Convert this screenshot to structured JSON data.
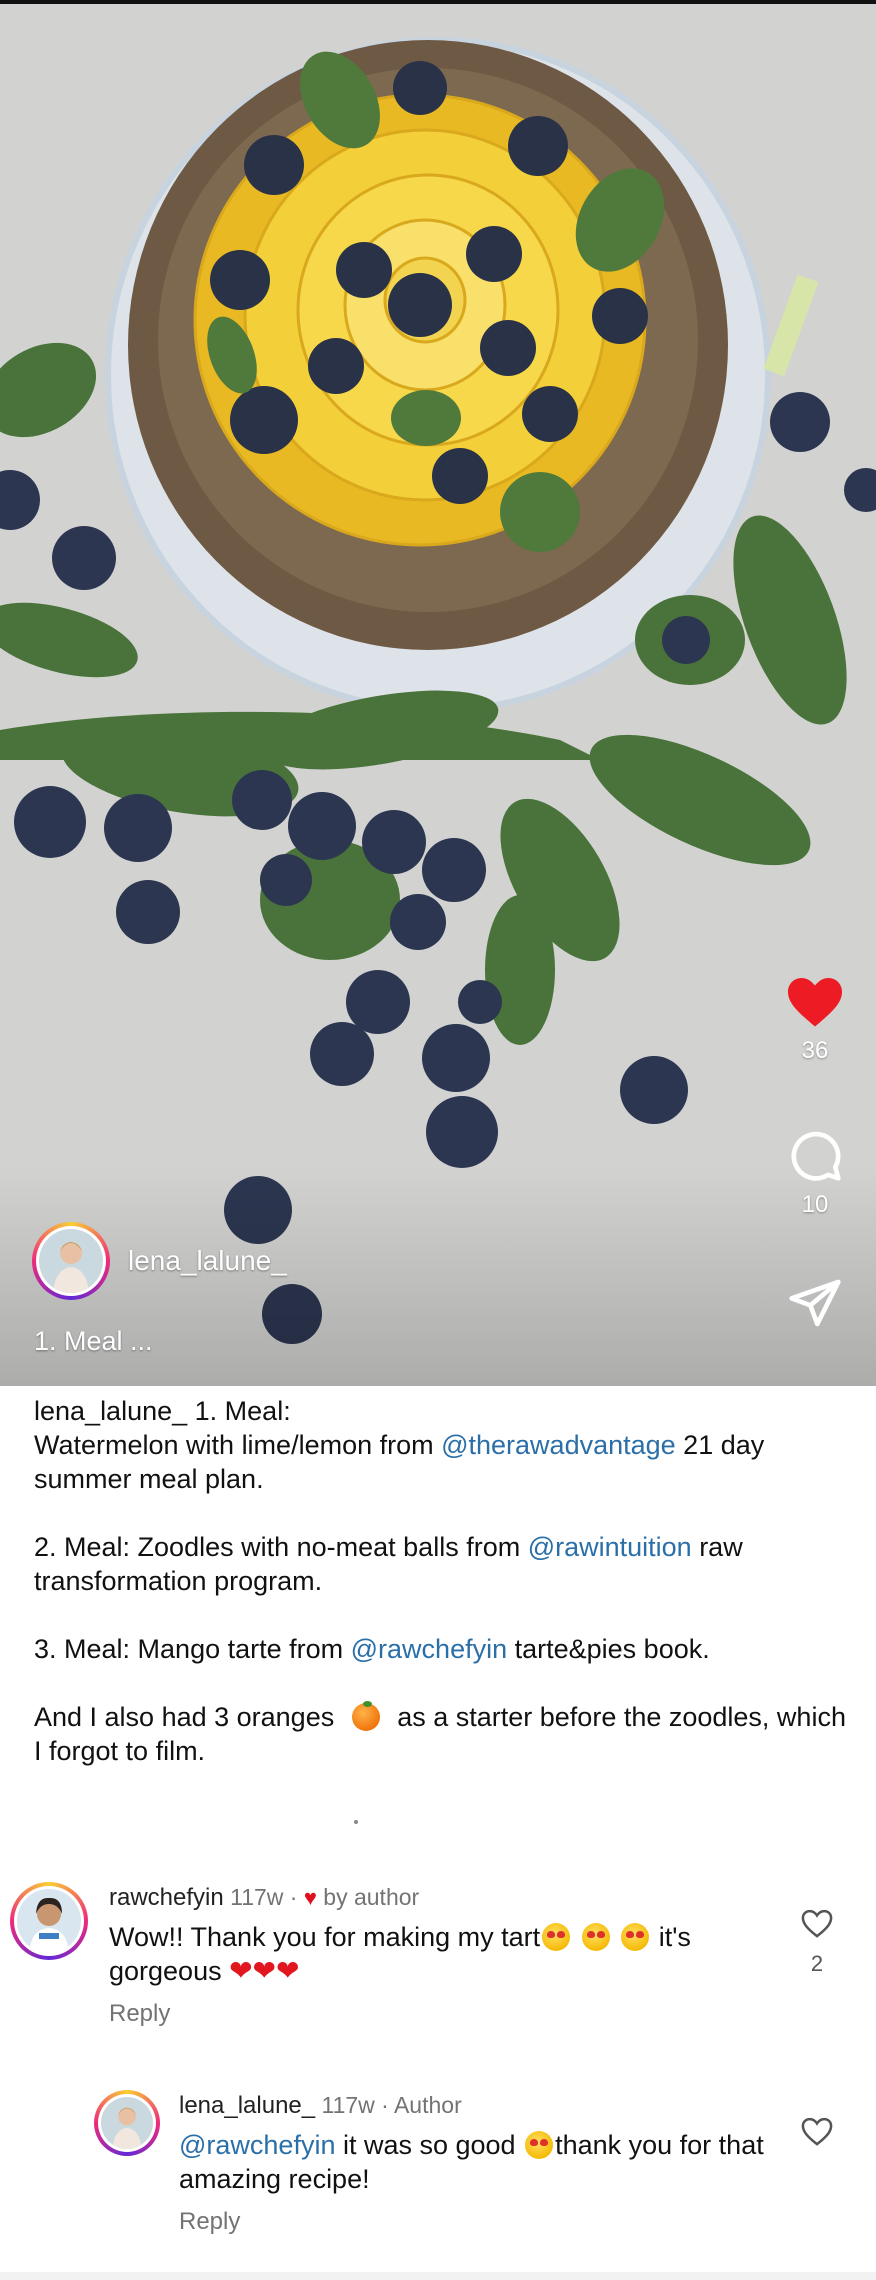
{
  "post": {
    "owner": "lena_lalune_",
    "caption_preview": "1. Meal ...",
    "likes": "36",
    "comments": "10"
  },
  "caption": {
    "user": "lena_lalune_",
    "p1": {
      "a": "1. Meal:",
      "b": "Watermelon with lime/lemon from ",
      "mention": "@therawadvantage",
      "c": " 21 day summer meal plan."
    },
    "p2": {
      "a": "2. Meal: Zoodles with no-meat balls from ",
      "mention": "@rawintuition",
      "b": " raw transformation program."
    },
    "p3": {
      "a": "3. Meal: Mango tarte from ",
      "mention": "@rawchefyin",
      "b": " tarte&pies book."
    },
    "p4": {
      "a": "And I also had 3 oranges ",
      "b": " as a starter before the zoodles, which I forgot to film."
    }
  },
  "comments": [
    {
      "user": "rawchefyin",
      "age": "117w",
      "sep": " · ",
      "heart": "♥",
      "badge": "by author",
      "text_a": "Wow!! Thank you for making my tart",
      "text_b": " it's gorgeous ",
      "hearts": "❤❤❤",
      "likes": "2",
      "reply": "Reply"
    },
    {
      "user": "lena_lalune_",
      "age": "117w",
      "sep": " · ",
      "badge": "Author",
      "mention": "@rawchefyin",
      "text_a": " it was so good ",
      "text_b": "thank you for that amazing recipe!",
      "reply": "Reply"
    }
  ],
  "icons": {
    "like": "heart-icon",
    "comment": "comment-bubble-icon",
    "share": "paper-plane-icon",
    "comment_like": "heart-outline-icon"
  },
  "colors": {
    "like_active": "#ed1c24",
    "mention": "#2b6fa8",
    "meta": "#737373"
  }
}
